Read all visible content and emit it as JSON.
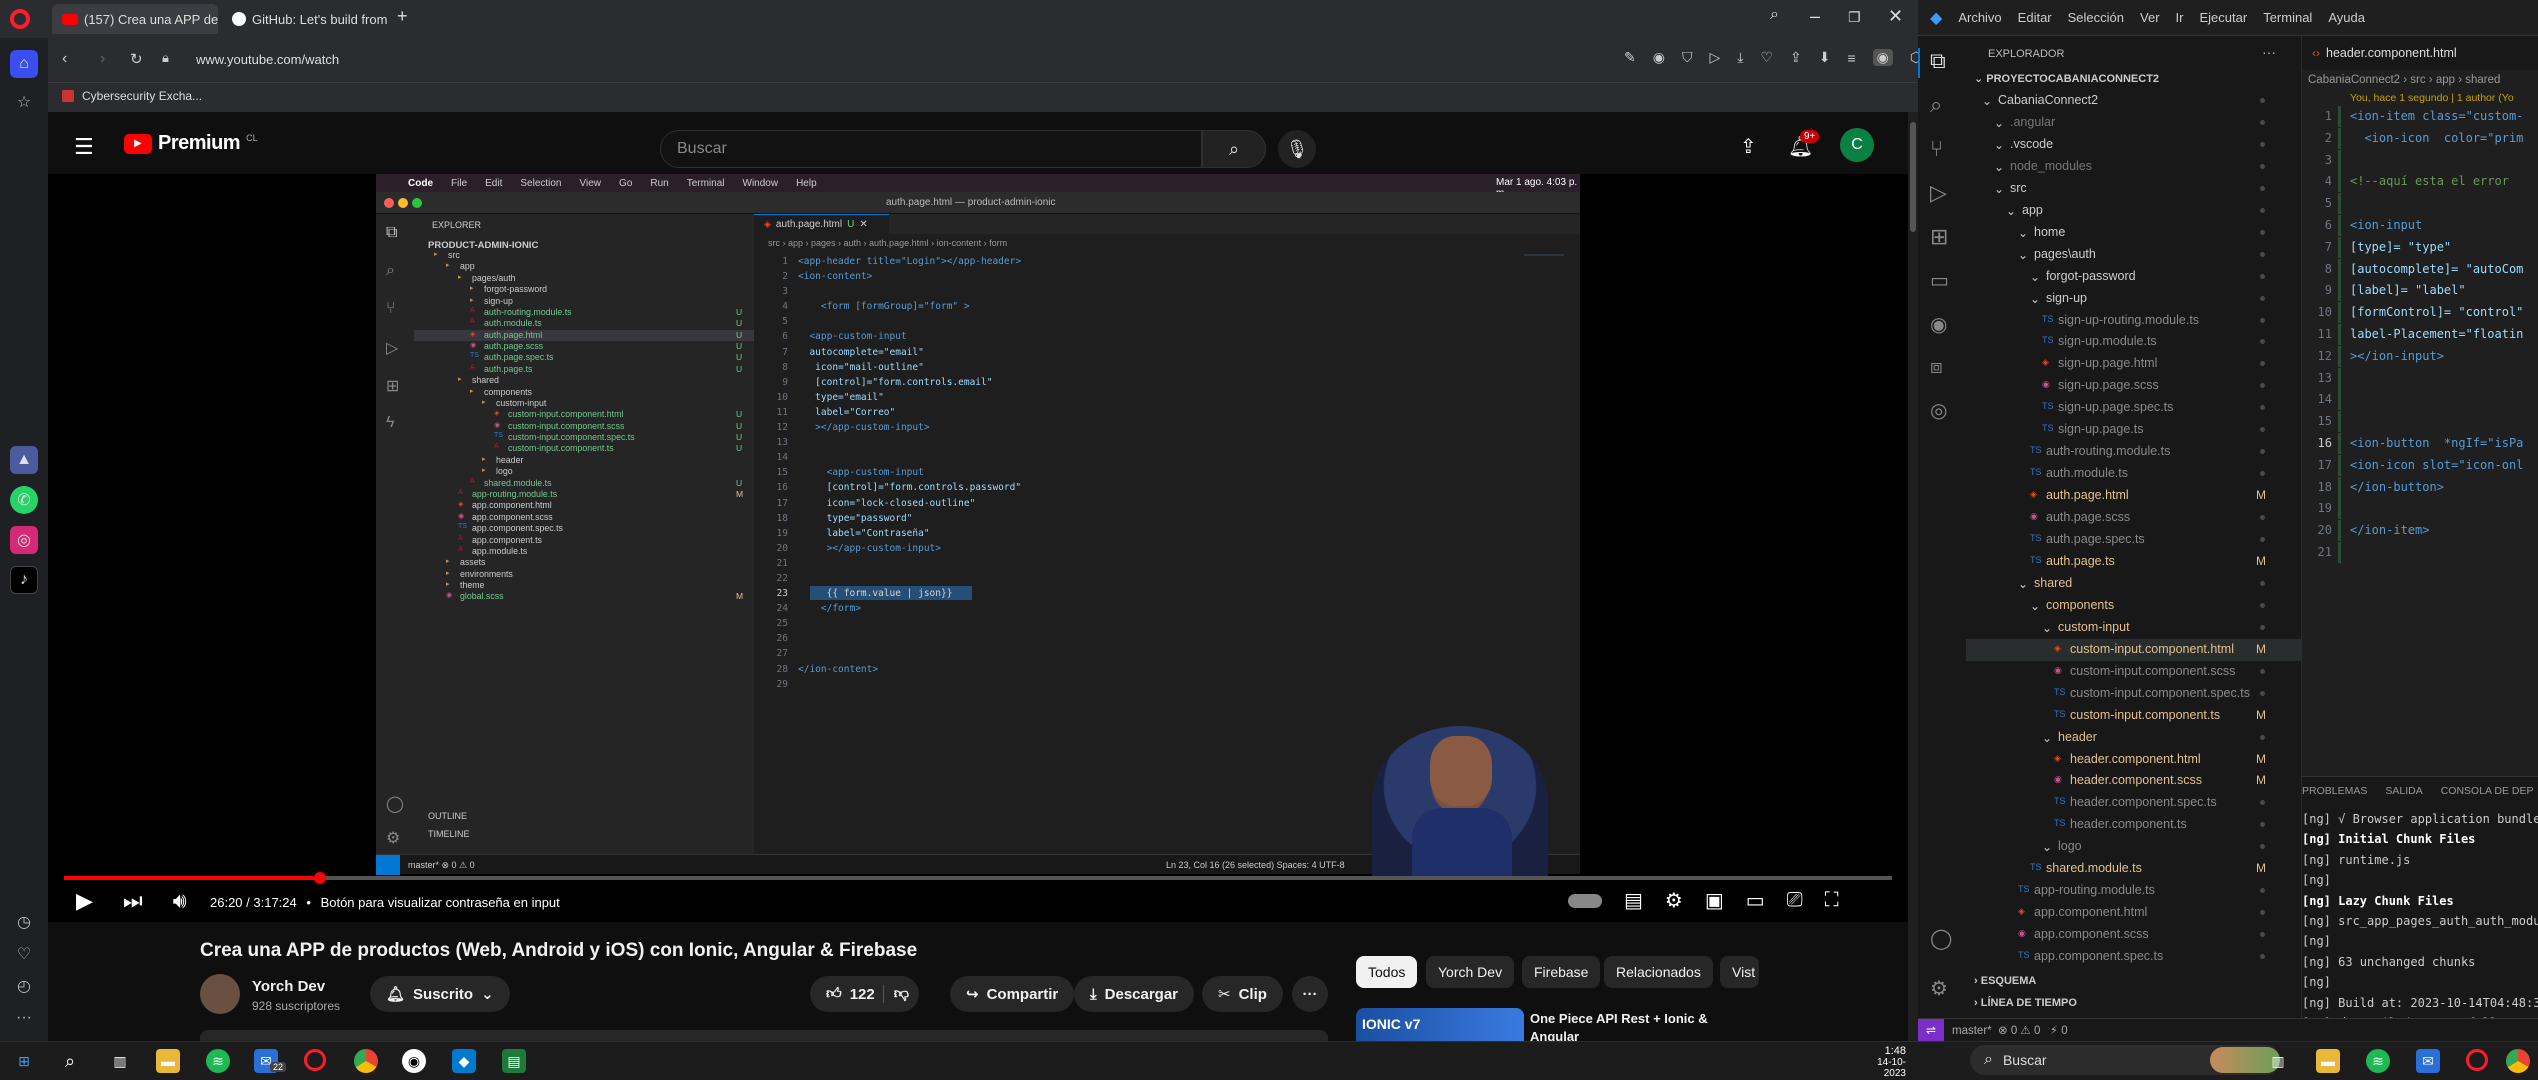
{
  "browser": {
    "tabs": [
      {
        "label": "(157) Crea una APP de pr"
      },
      {
        "label": "GitHub: Let's build from h"
      }
    ],
    "url": "www.youtube.com/watch",
    "bookmark": "Cybersecurity Excha..."
  },
  "youtube": {
    "logo": "Premium",
    "region": "CL",
    "search_placeholder": "Buscar",
    "notif_count": "9+",
    "avatar_letter": "C",
    "time": "26:20 / 3:17:24",
    "chapter": "Botón para visualizar contraseña en input",
    "title": "Crea una APP de productos (Web, Android y iOS) con Ionic, Angular & Firebase",
    "channel": "Yorch Dev",
    "subs": "928 suscriptores",
    "subscribed": "Suscrito",
    "likes": "122",
    "share": "Compartir",
    "download": "Descargar",
    "clip": "Clip",
    "chips": [
      "Todos",
      "Yorch Dev",
      "Firebase",
      "Relacionados",
      "Vist"
    ],
    "rec_title": "One Piece API Rest + Ionic & Angular",
    "rec_badge": "IONIC v7"
  },
  "mac": {
    "menu": [
      "Code",
      "File",
      "Edit",
      "Selection",
      "View",
      "Go",
      "Run",
      "Terminal",
      "Window",
      "Help"
    ],
    "clock": "Mar 1 ago.  4:03 p. m.",
    "window_title": "auth.page.html — product-admin-ionic",
    "explorer": "EXPLORER",
    "project": "PRODUCT-ADMIN-IONIC",
    "tab": "auth.page.html",
    "breadcrumb": "src › app › pages › auth › auth.page.html › ion-content › form",
    "tree": [
      {
        "n": "src",
        "d": 1,
        "k": "f"
      },
      {
        "n": "app",
        "d": 2,
        "k": "f"
      },
      {
        "n": "pages/auth",
        "d": 3,
        "k": "f"
      },
      {
        "n": "forgot-password",
        "d": 4,
        "k": "f"
      },
      {
        "n": "sign-up",
        "d": 4,
        "k": "f"
      },
      {
        "n": "auth-routing.module.ts",
        "d": 4,
        "k": "a",
        "g": "U"
      },
      {
        "n": "auth.module.ts",
        "d": 4,
        "k": "a",
        "g": "U"
      },
      {
        "n": "auth.page.html",
        "d": 4,
        "k": "h",
        "g": "U",
        "sel": true
      },
      {
        "n": "auth.page.scss",
        "d": 4,
        "k": "s",
        "g": "U"
      },
      {
        "n": "auth.page.spec.ts",
        "d": 4,
        "k": "t",
        "g": "U"
      },
      {
        "n": "auth.page.ts",
        "d": 4,
        "k": "a",
        "g": "U"
      },
      {
        "n": "shared",
        "d": 3,
        "k": "f"
      },
      {
        "n": "components",
        "d": 4,
        "k": "f"
      },
      {
        "n": "custom-input",
        "d": 5,
        "k": "f"
      },
      {
        "n": "custom-input.component.html",
        "d": 6,
        "k": "h",
        "g": "U"
      },
      {
        "n": "custom-input.component.scss",
        "d": 6,
        "k": "s",
        "g": "U"
      },
      {
        "n": "custom-input.component.spec.ts",
        "d": 6,
        "k": "t",
        "g": "U"
      },
      {
        "n": "custom-input.component.ts",
        "d": 6,
        "k": "a",
        "g": "U"
      },
      {
        "n": "header",
        "d": 5,
        "k": "f"
      },
      {
        "n": "logo",
        "d": 5,
        "k": "f"
      },
      {
        "n": "shared.module.ts",
        "d": 4,
        "k": "a",
        "g": "U"
      },
      {
        "n": "app-routing.module.ts",
        "d": 3,
        "k": "a",
        "g": "M"
      },
      {
        "n": "app.component.html",
        "d": 3,
        "k": "h"
      },
      {
        "n": "app.component.scss",
        "d": 3,
        "k": "s"
      },
      {
        "n": "app.component.spec.ts",
        "d": 3,
        "k": "t"
      },
      {
        "n": "app.component.ts",
        "d": 3,
        "k": "a"
      },
      {
        "n": "app.module.ts",
        "d": 3,
        "k": "a"
      },
      {
        "n": "assets",
        "d": 2,
        "k": "f"
      },
      {
        "n": "environments",
        "d": 2,
        "k": "f"
      },
      {
        "n": "theme",
        "d": 2,
        "k": "f"
      },
      {
        "n": "global.scss",
        "d": 2,
        "k": "s",
        "g": "M"
      }
    ],
    "outline": "OUTLINE",
    "timeline": "TIMELINE",
    "code": [
      "<app-header title=\"Login\"></app-header>",
      "<ion-content>",
      "",
      "    <form [formGroup]=\"form\" >",
      "",
      "  <app-custom-input",
      "  autocomplete=\"email\"",
      "   icon=\"mail-outline\"",
      "   [control]=\"form.controls.email\"",
      "   type=\"email\"",
      "   label=\"Correo\"",
      "   ></app-custom-input>",
      "",
      "",
      "     <app-custom-input",
      "     [control]=\"form.controls.password\"",
      "     icon=\"lock-closed-outline\"",
      "     type=\"password\"",
      "     label=\"Contraseña\"",
      "     ></app-custom-input>",
      "",
      "",
      "     {{ form.value | json}}",
      "    </form>",
      "",
      "",
      "",
      "</ion-content>",
      ""
    ],
    "status_left": "master*  ⊗ 0 ⚠ 0",
    "status_right": "Ln 23, Col 16 (26 selected)  Spaces: 4  UTF-8"
  },
  "vscode": {
    "menu": [
      "Archivo",
      "Editar",
      "Selección",
      "Ver",
      "Ir",
      "Ejecutar",
      "Terminal",
      "Ayuda"
    ],
    "tab": "header.component.html",
    "explorer": "EXPLORADOR",
    "project": "PROYECTOCABANIACONNECT2",
    "breadcrumb": "CabaniaConnect2 › src › app › shared",
    "blame": "You, hace 1 segundo | 1 author (Yo",
    "tree": [
      {
        "n": "CabaniaConnect2",
        "d": 1,
        "k": "f",
        "c": "#ccc"
      },
      {
        "n": ".angular",
        "d": 2,
        "k": "f",
        "c": "#777"
      },
      {
        "n": ".vscode",
        "d": 2,
        "k": "f",
        "c": "#ccc"
      },
      {
        "n": "node_modules",
        "d": 2,
        "k": "f",
        "c": "#777"
      },
      {
        "n": "src",
        "d": 2,
        "k": "f",
        "c": "#ccc"
      },
      {
        "n": "app",
        "d": 3,
        "k": "f",
        "c": "#ccc"
      },
      {
        "n": "home",
        "d": 4,
        "k": "f",
        "c": "#ccc"
      },
      {
        "n": "pages\\auth",
        "d": 4,
        "k": "f",
        "c": "#ccc"
      },
      {
        "n": "forgot-password",
        "d": 5,
        "k": "f",
        "c": "#ccc"
      },
      {
        "n": "sign-up",
        "d": 5,
        "k": "f",
        "c": "#ccc"
      },
      {
        "n": "sign-up-routing.module.ts",
        "d": 6,
        "k": "t",
        "c": "#8a8a8a"
      },
      {
        "n": "sign-up.module.ts",
        "d": 6,
        "k": "t",
        "c": "#8a8a8a"
      },
      {
        "n": "sign-up.page.html",
        "d": 6,
        "k": "h",
        "c": "#8a8a8a"
      },
      {
        "n": "sign-up.page.scss",
        "d": 6,
        "k": "s",
        "c": "#8a8a8a"
      },
      {
        "n": "sign-up.page.spec.ts",
        "d": 6,
        "k": "t",
        "c": "#8a8a8a"
      },
      {
        "n": "sign-up.page.ts",
        "d": 6,
        "k": "t",
        "c": "#8a8a8a"
      },
      {
        "n": "auth-routing.module.ts",
        "d": 5,
        "k": "t",
        "c": "#8a8a8a"
      },
      {
        "n": "auth.module.ts",
        "d": 5,
        "k": "t",
        "c": "#8a8a8a"
      },
      {
        "n": "auth.page.html",
        "d": 5,
        "k": "h",
        "c": "#e2c08d",
        "g": "M"
      },
      {
        "n": "auth.page.scss",
        "d": 5,
        "k": "s",
        "c": "#8a8a8a"
      },
      {
        "n": "auth.page.spec.ts",
        "d": 5,
        "k": "t",
        "c": "#8a8a8a"
      },
      {
        "n": "auth.page.ts",
        "d": 5,
        "k": "t",
        "c": "#e2c08d",
        "g": "M"
      },
      {
        "n": "shared",
        "d": 4,
        "k": "f",
        "c": "#e2c08d"
      },
      {
        "n": "components",
        "d": 5,
        "k": "f",
        "c": "#e2c08d"
      },
      {
        "n": "custom-input",
        "d": 6,
        "k": "f",
        "c": "#e2c08d"
      },
      {
        "n": "custom-input.component.html",
        "d": 7,
        "k": "h",
        "c": "#e2c08d",
        "g": "M",
        "sel": true
      },
      {
        "n": "custom-input.component.scss",
        "d": 7,
        "k": "s",
        "c": "#8a8a8a"
      },
      {
        "n": "custom-input.component.spec.ts",
        "d": 7,
        "k": "t",
        "c": "#8a8a8a"
      },
      {
        "n": "custom-input.component.ts",
        "d": 7,
        "k": "t",
        "c": "#e2c08d",
        "g": "M"
      },
      {
        "n": "header",
        "d": 6,
        "k": "f",
        "c": "#e2c08d"
      },
      {
        "n": "header.component.html",
        "d": 7,
        "k": "h",
        "c": "#e2c08d",
        "g": "M"
      },
      {
        "n": "header.component.scss",
        "d": 7,
        "k": "s",
        "c": "#e2c08d",
        "g": "M"
      },
      {
        "n": "header.component.spec.ts",
        "d": 7,
        "k": "t",
        "c": "#8a8a8a"
      },
      {
        "n": "header.component.ts",
        "d": 7,
        "k": "t",
        "c": "#8a8a8a"
      },
      {
        "n": "logo",
        "d": 6,
        "k": "f",
        "c": "#8a8a8a"
      },
      {
        "n": "shared.module.ts",
        "d": 5,
        "k": "t",
        "c": "#e2c08d",
        "g": "M"
      },
      {
        "n": "app-routing.module.ts",
        "d": 4,
        "k": "t",
        "c": "#8a8a8a"
      },
      {
        "n": "app.component.html",
        "d": 4,
        "k": "h",
        "c": "#8a8a8a"
      },
      {
        "n": "app.component.scss",
        "d": 4,
        "k": "s",
        "c": "#8a8a8a"
      },
      {
        "n": "app.component.spec.ts",
        "d": 4,
        "k": "t",
        "c": "#8a8a8a"
      }
    ],
    "outline": "ESQUEMA",
    "timeline": "LÍNEA DE TIEMPO",
    "code": [
      {
        "ln": "1",
        "t": "<ion-item class=\"custom-"
      },
      {
        "ln": "2",
        "t": "  <ion-icon  color=\"prim"
      },
      {
        "ln": "3",
        "t": ""
      },
      {
        "ln": "4",
        "t": "<!--aquí esta el error"
      },
      {
        "ln": "5",
        "t": ""
      },
      {
        "ln": "6",
        "t": "<ion-input"
      },
      {
        "ln": "7",
        "t": "[type]= \"type\""
      },
      {
        "ln": "8",
        "t": "[autocomplete]= \"autoCom"
      },
      {
        "ln": "9",
        "t": "[label]= \"label\""
      },
      {
        "ln": "10",
        "t": "[formControl]= \"control\""
      },
      {
        "ln": "11",
        "t": "label-Placement=\"floatin"
      },
      {
        "ln": "12",
        "t": "></ion-input>"
      },
      {
        "ln": "13",
        "t": ""
      },
      {
        "ln": "14",
        "t": ""
      },
      {
        "ln": "15",
        "t": ""
      },
      {
        "ln": "16",
        "t": "<ion-button  *ngIf=\"isPa"
      },
      {
        "ln": "17",
        "t": "<ion-icon slot=\"icon-onl"
      },
      {
        "ln": "18",
        "t": "</ion-button>"
      },
      {
        "ln": "19",
        "t": ""
      },
      {
        "ln": "20",
        "t": "</ion-item>"
      },
      {
        "ln": "21",
        "t": ""
      }
    ],
    "panel_tabs": [
      "PROBLEMAS",
      "SALIDA",
      "CONSOLA DE DEP"
    ],
    "terminal": [
      "[ng] √ Browser application bundle",
      "[ng] Initial Chunk Files",
      "[ng] runtime.js",
      "[ng]",
      "[ng] Lazy Chunk Files",
      "[ng] src_app_pages_auth_auth_modu",
      "[ng]",
      "[ng] 63 unchanged chunks",
      "[ng]",
      "[ng] Build at: 2023-10-14T04:48:3",
      "[ng] √ Compiled successfully.",
      "[ng]"
    ],
    "status": "master*  ⊗ 0 ⚠ 0   ⚡ 0"
  },
  "taskbar": {
    "search": "Buscar",
    "time": "1:48",
    "date": "14-10-2023",
    "mail_badge": "22"
  }
}
